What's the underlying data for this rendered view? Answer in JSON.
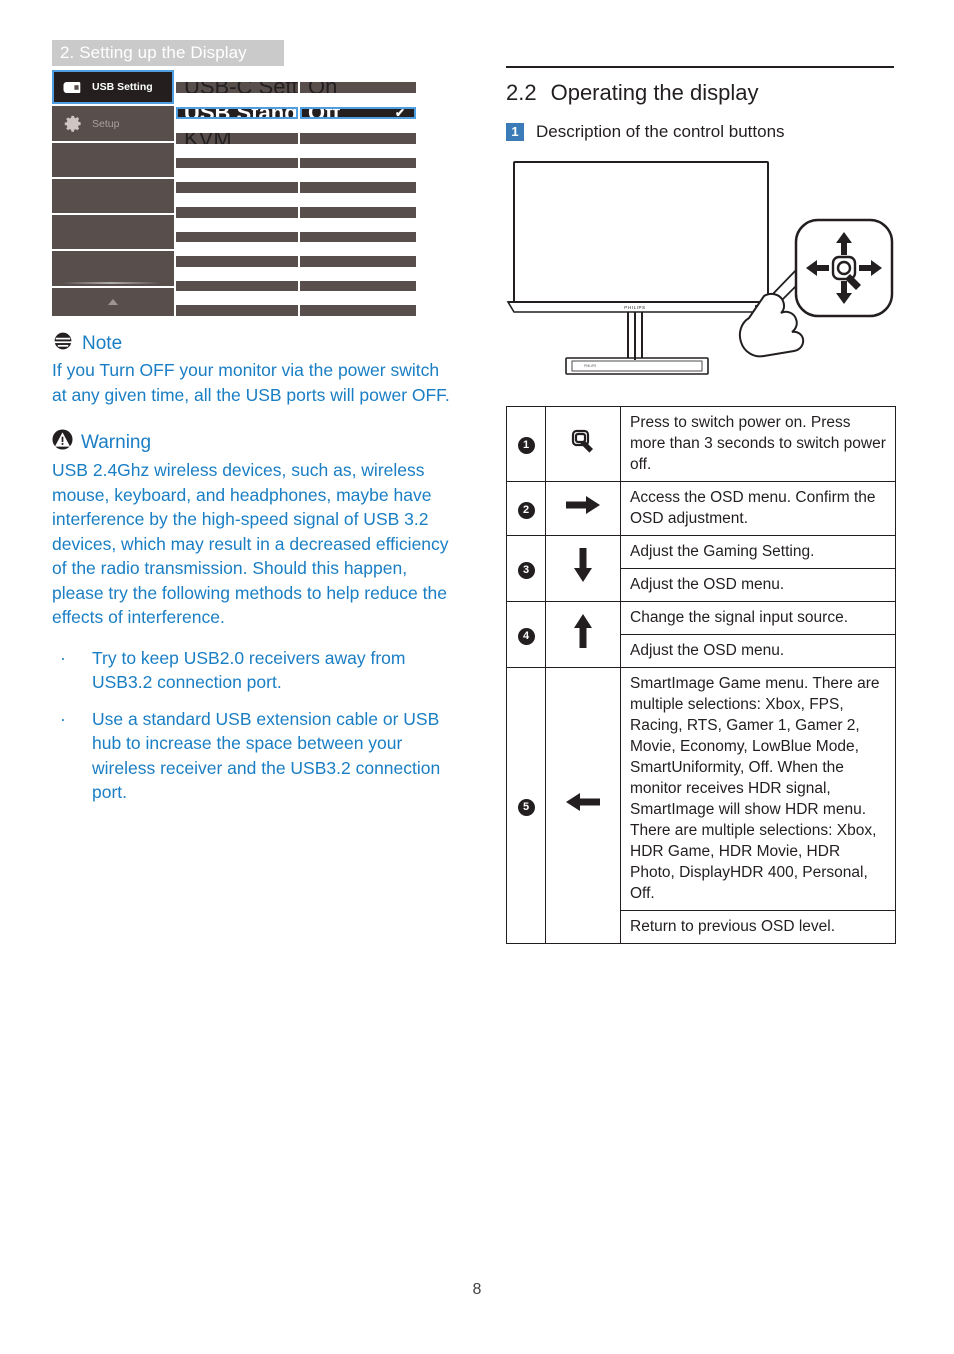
{
  "header": {
    "section_banner": "2. Setting up the Display"
  },
  "osd": {
    "left_items": [
      {
        "label": "USB Setting",
        "icon": "usb-icon",
        "selected": true
      },
      {
        "label": "Setup",
        "icon": "gear-icon",
        "selected": false
      }
    ],
    "middle_items": [
      {
        "label": "USB-C Setting",
        "selected": false
      },
      {
        "label": "USB Standby Mode",
        "selected": true
      },
      {
        "label": "KVM",
        "selected": false
      }
    ],
    "right_items": [
      {
        "label": "On",
        "selected": false,
        "checked": false
      },
      {
        "label": "Off",
        "selected": true,
        "checked": true
      }
    ],
    "check_glyph": "✔",
    "scroll_down_glyph": "▲",
    "colors": {
      "panel": "#584f4d",
      "selected_bg": "#241f1e",
      "highlight_border": "#4f9fe0",
      "dim_text": "#a9a09e"
    }
  },
  "note": {
    "icon": "note-icon",
    "title": "Note",
    "body": "If you Turn OFF your monitor via the power switch at any given time, all the USB ports will power OFF."
  },
  "warning": {
    "icon": "warning-icon",
    "title": "Warning",
    "body": "USB 2.4Ghz wireless devices, such as, wireless mouse, keyboard, and headphones, maybe have interference by the high-speed signal of USB 3.2 devices, which may result in a decreased efficiency of the radio transmission.  Should this happen, please try the following methods to help reduce the effects of interference.",
    "bullet_glyph": "·",
    "bullets": [
      "Try to keep USB2.0 receivers away from USB3.2 connection port.",
      "Use a standard USB extension cable or USB hub to increase the space between your wireless receiver and the USB3.2 connection port."
    ]
  },
  "right": {
    "section_number": "2.2",
    "section_title": "Operating the display",
    "sub_badge": "1",
    "sub_title": "Description of the control buttons",
    "monitor_brand": "PHILIPS",
    "table_rows": [
      {
        "num": "1",
        "icon": "joystick-press-icon",
        "lines": [
          "Press to switch power on. Press more than 3 seconds to switch power off."
        ]
      },
      {
        "num": "2",
        "icon": "arrow-right-icon",
        "lines": [
          "Access the OSD menu. Confirm the OSD adjustment."
        ]
      },
      {
        "num": "3",
        "icon": "arrow-down-icon",
        "lines": [
          "Adjust the Gaming Setting.",
          "Adjust the OSD menu."
        ]
      },
      {
        "num": "4",
        "icon": "arrow-up-icon",
        "lines": [
          "Change the signal input source.",
          "Adjust the OSD menu."
        ]
      },
      {
        "num": "5",
        "icon": "arrow-left-icon",
        "lines": [
          "SmartImage Game menu. There are multiple selections: Xbox, FPS, Racing, RTS, Gamer 1, Gamer 2, Movie, Economy, LowBlue Mode, SmartUniformity, Off. When the monitor receives HDR signal, SmartImage will show HDR menu. There are multiple selections: Xbox, HDR Game, HDR Movie, HDR Photo, DisplayHDR 400, Personal, Off.",
          "Return to previous OSD level."
        ]
      }
    ]
  },
  "footer": {
    "page_number": "8"
  },
  "colors": {
    "accent_blue": "#1a7ec4",
    "badge_blue": "#3b7cb8",
    "ink": "#231f20",
    "banner_gray": "#cacaca"
  }
}
